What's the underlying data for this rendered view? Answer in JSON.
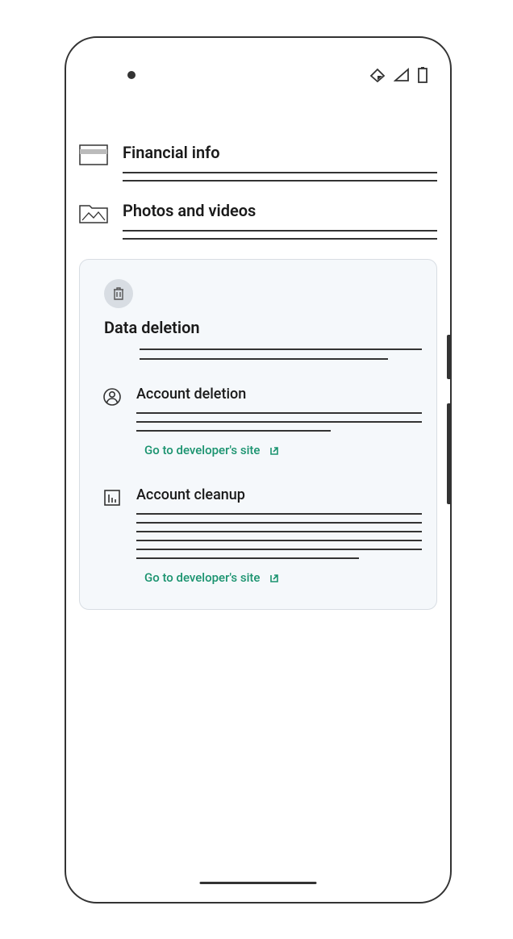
{
  "sections": [
    {
      "title": "Financial info",
      "icon": "card-icon"
    },
    {
      "title": "Photos and videos",
      "icon": "folder-photo-icon"
    }
  ],
  "card": {
    "title": "Data deletion",
    "subsections": [
      {
        "title": "Account deletion",
        "link_label": "Go to developer's site"
      },
      {
        "title": "Account cleanup",
        "link_label": "Go to developer's site"
      }
    ]
  }
}
